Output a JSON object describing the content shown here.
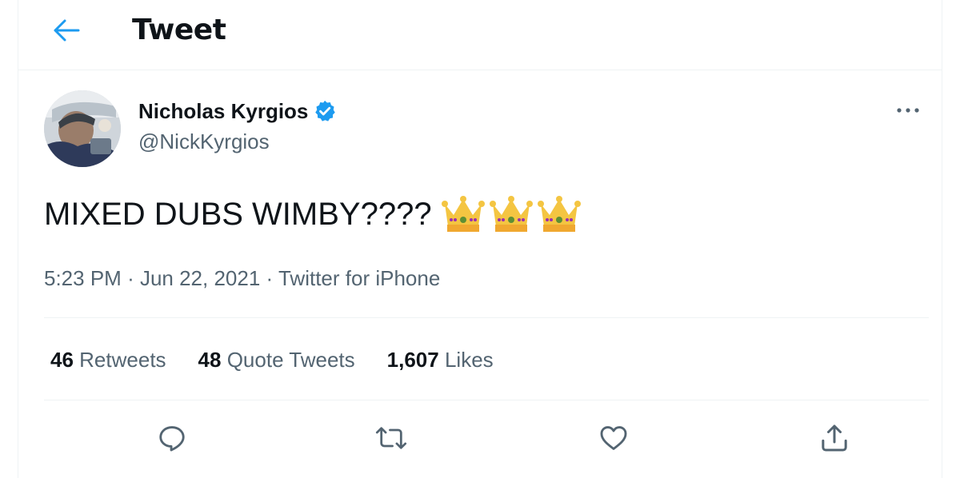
{
  "header": {
    "title": "Tweet",
    "back_icon": "arrow-left-icon"
  },
  "author": {
    "name": "Nicholas Kyrgios",
    "handle": "@NickKyrgios",
    "verified_icon": "verified-badge-icon"
  },
  "tweet": {
    "text": "MIXED DUBS WIMBY????",
    "emoji": [
      "crown",
      "crown",
      "crown"
    ],
    "time": "5:23 PM",
    "date": "Jun 22, 2021",
    "source": "Twitter for iPhone"
  },
  "stats": {
    "retweets": {
      "count": "46",
      "label": "Retweets"
    },
    "quotes": {
      "count": "48",
      "label": "Quote Tweets"
    },
    "likes": {
      "count": "1,607",
      "label": "Likes"
    }
  },
  "actions": [
    "reply-icon",
    "retweet-icon",
    "like-icon",
    "share-icon"
  ],
  "colors": {
    "accent": "#1d9bf0",
    "text": "#0f1419",
    "secondary": "#536471",
    "border": "#eff3f4"
  }
}
